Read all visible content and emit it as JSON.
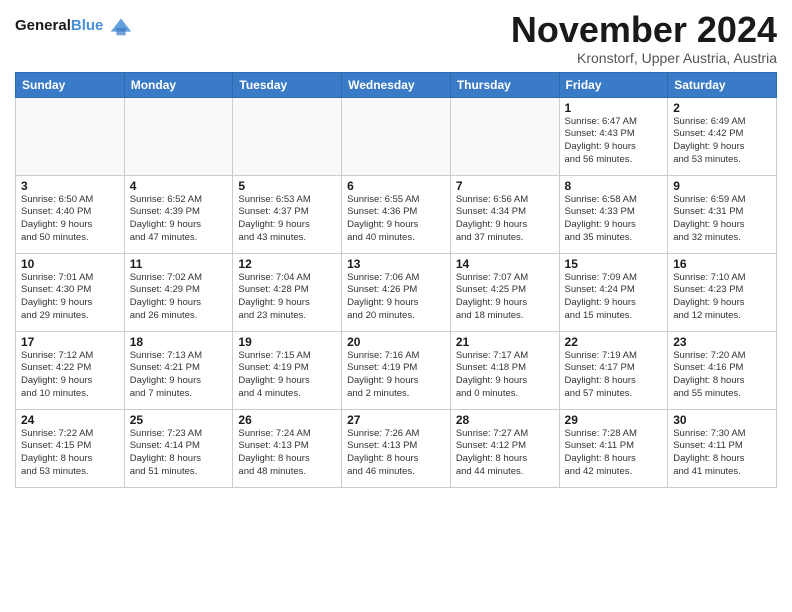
{
  "header": {
    "logo_line1": "General",
    "logo_line2": "Blue",
    "month_title": "November 2024",
    "location": "Kronstorf, Upper Austria, Austria"
  },
  "weekdays": [
    "Sunday",
    "Monday",
    "Tuesday",
    "Wednesday",
    "Thursday",
    "Friday",
    "Saturday"
  ],
  "weeks": [
    [
      {
        "day": "",
        "info": ""
      },
      {
        "day": "",
        "info": ""
      },
      {
        "day": "",
        "info": ""
      },
      {
        "day": "",
        "info": ""
      },
      {
        "day": "",
        "info": ""
      },
      {
        "day": "1",
        "info": "Sunrise: 6:47 AM\nSunset: 4:43 PM\nDaylight: 9 hours\nand 56 minutes."
      },
      {
        "day": "2",
        "info": "Sunrise: 6:49 AM\nSunset: 4:42 PM\nDaylight: 9 hours\nand 53 minutes."
      }
    ],
    [
      {
        "day": "3",
        "info": "Sunrise: 6:50 AM\nSunset: 4:40 PM\nDaylight: 9 hours\nand 50 minutes."
      },
      {
        "day": "4",
        "info": "Sunrise: 6:52 AM\nSunset: 4:39 PM\nDaylight: 9 hours\nand 47 minutes."
      },
      {
        "day": "5",
        "info": "Sunrise: 6:53 AM\nSunset: 4:37 PM\nDaylight: 9 hours\nand 43 minutes."
      },
      {
        "day": "6",
        "info": "Sunrise: 6:55 AM\nSunset: 4:36 PM\nDaylight: 9 hours\nand 40 minutes."
      },
      {
        "day": "7",
        "info": "Sunrise: 6:56 AM\nSunset: 4:34 PM\nDaylight: 9 hours\nand 37 minutes."
      },
      {
        "day": "8",
        "info": "Sunrise: 6:58 AM\nSunset: 4:33 PM\nDaylight: 9 hours\nand 35 minutes."
      },
      {
        "day": "9",
        "info": "Sunrise: 6:59 AM\nSunset: 4:31 PM\nDaylight: 9 hours\nand 32 minutes."
      }
    ],
    [
      {
        "day": "10",
        "info": "Sunrise: 7:01 AM\nSunset: 4:30 PM\nDaylight: 9 hours\nand 29 minutes."
      },
      {
        "day": "11",
        "info": "Sunrise: 7:02 AM\nSunset: 4:29 PM\nDaylight: 9 hours\nand 26 minutes."
      },
      {
        "day": "12",
        "info": "Sunrise: 7:04 AM\nSunset: 4:28 PM\nDaylight: 9 hours\nand 23 minutes."
      },
      {
        "day": "13",
        "info": "Sunrise: 7:06 AM\nSunset: 4:26 PM\nDaylight: 9 hours\nand 20 minutes."
      },
      {
        "day": "14",
        "info": "Sunrise: 7:07 AM\nSunset: 4:25 PM\nDaylight: 9 hours\nand 18 minutes."
      },
      {
        "day": "15",
        "info": "Sunrise: 7:09 AM\nSunset: 4:24 PM\nDaylight: 9 hours\nand 15 minutes."
      },
      {
        "day": "16",
        "info": "Sunrise: 7:10 AM\nSunset: 4:23 PM\nDaylight: 9 hours\nand 12 minutes."
      }
    ],
    [
      {
        "day": "17",
        "info": "Sunrise: 7:12 AM\nSunset: 4:22 PM\nDaylight: 9 hours\nand 10 minutes."
      },
      {
        "day": "18",
        "info": "Sunrise: 7:13 AM\nSunset: 4:21 PM\nDaylight: 9 hours\nand 7 minutes."
      },
      {
        "day": "19",
        "info": "Sunrise: 7:15 AM\nSunset: 4:19 PM\nDaylight: 9 hours\nand 4 minutes."
      },
      {
        "day": "20",
        "info": "Sunrise: 7:16 AM\nSunset: 4:19 PM\nDaylight: 9 hours\nand 2 minutes."
      },
      {
        "day": "21",
        "info": "Sunrise: 7:17 AM\nSunset: 4:18 PM\nDaylight: 9 hours\nand 0 minutes."
      },
      {
        "day": "22",
        "info": "Sunrise: 7:19 AM\nSunset: 4:17 PM\nDaylight: 8 hours\nand 57 minutes."
      },
      {
        "day": "23",
        "info": "Sunrise: 7:20 AM\nSunset: 4:16 PM\nDaylight: 8 hours\nand 55 minutes."
      }
    ],
    [
      {
        "day": "24",
        "info": "Sunrise: 7:22 AM\nSunset: 4:15 PM\nDaylight: 8 hours\nand 53 minutes."
      },
      {
        "day": "25",
        "info": "Sunrise: 7:23 AM\nSunset: 4:14 PM\nDaylight: 8 hours\nand 51 minutes."
      },
      {
        "day": "26",
        "info": "Sunrise: 7:24 AM\nSunset: 4:13 PM\nDaylight: 8 hours\nand 48 minutes."
      },
      {
        "day": "27",
        "info": "Sunrise: 7:26 AM\nSunset: 4:13 PM\nDaylight: 8 hours\nand 46 minutes."
      },
      {
        "day": "28",
        "info": "Sunrise: 7:27 AM\nSunset: 4:12 PM\nDaylight: 8 hours\nand 44 minutes."
      },
      {
        "day": "29",
        "info": "Sunrise: 7:28 AM\nSunset: 4:11 PM\nDaylight: 8 hours\nand 42 minutes."
      },
      {
        "day": "30",
        "info": "Sunrise: 7:30 AM\nSunset: 4:11 PM\nDaylight: 8 hours\nand 41 minutes."
      }
    ]
  ]
}
